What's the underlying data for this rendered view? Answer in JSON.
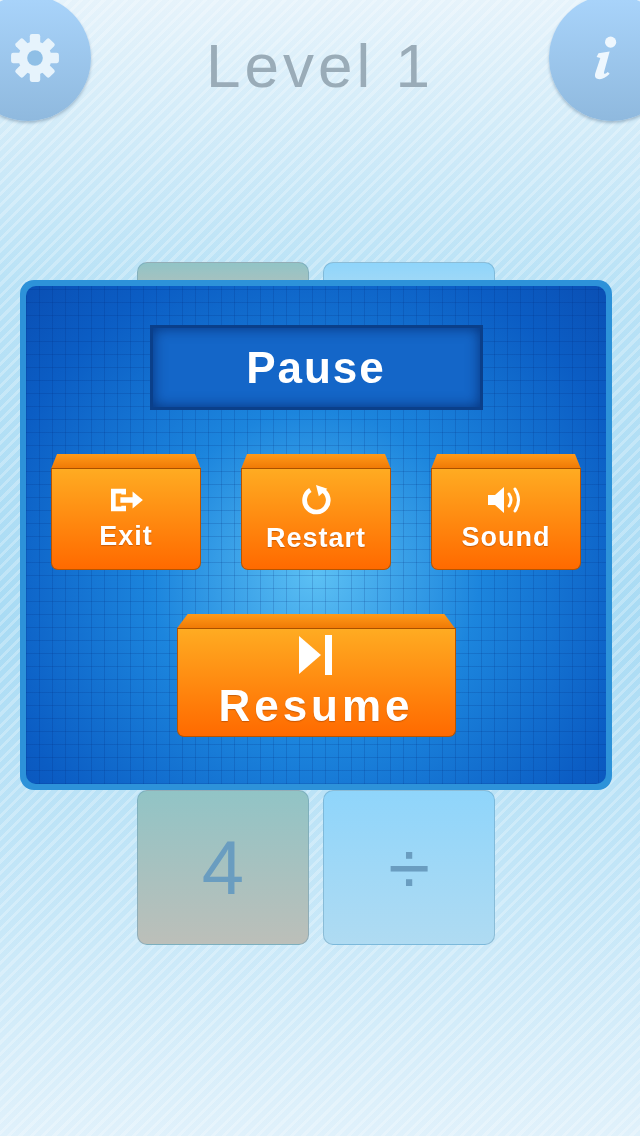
{
  "header": {
    "title": "Level 1"
  },
  "tiles_top": [
    {
      "kind": "number"
    },
    {
      "kind": "operator"
    }
  ],
  "pause_dialog": {
    "title": "Pause",
    "buttons": [
      {
        "label": "Exit",
        "kind": "exit"
      },
      {
        "label": "Restart",
        "kind": "restart"
      },
      {
        "label": "Sound",
        "kind": "sound"
      }
    ],
    "resume": {
      "label": "Resume"
    }
  },
  "tiles": [
    {
      "label": "4",
      "kind": "number"
    },
    {
      "label": "÷",
      "kind": "operator"
    }
  ]
}
